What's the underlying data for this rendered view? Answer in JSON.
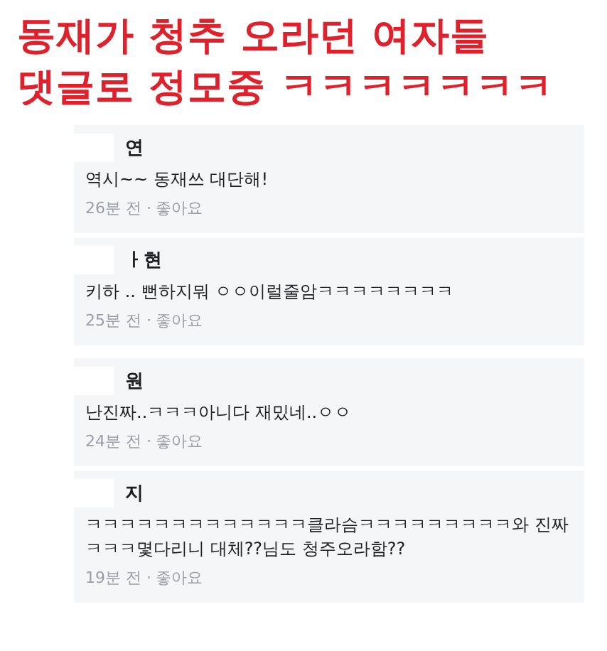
{
  "headline": [
    "동재가 청추 오라던 여자들",
    "댓글로 정모중 ㅋㅋㅋㅋㅋㅋㅋ"
  ],
  "comments": [
    {
      "name": "연",
      "text": "역시~~ 동재쓰 대단해!",
      "time": "26분 전 ·",
      "like": "좋아요"
    },
    {
      "name": "ㅏ현",
      "text": "키하 .. 뻔하지뭐 ㅇㅇ이럴줄암ㅋㅋㅋㅋㅋㅋㅋㅋ",
      "time": "25분 전 ·",
      "like": "좋아요"
    },
    {
      "name": "원",
      "text": "난진짜..ㅋㅋㅋ아니다 재밌네..ㅇㅇ",
      "time": "24분 전 ·",
      "like": "좋아요"
    },
    {
      "name": "지",
      "text": "ㅋㅋㅋㅋㅋㅋㅋㅋㅋㅋㅋㅋㅋ클라슴ㅋㅋㅋㅋㅋㅋㅋㅋㅋ와 진짜ㅋㅋㅋ몇다리니 대체??님도 청주오라함??",
      "time": "19분 전 ·",
      "like": "좋아요"
    }
  ]
}
